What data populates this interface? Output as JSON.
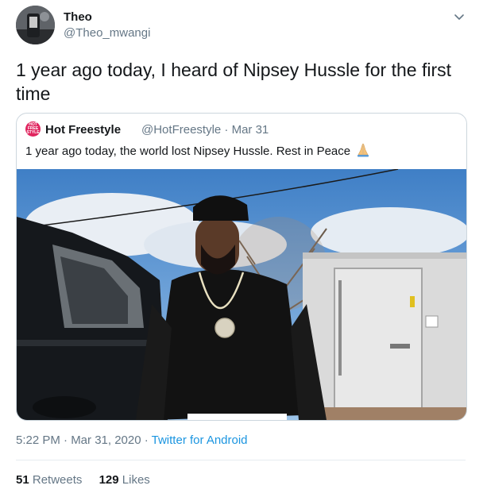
{
  "author": {
    "name": "Theo",
    "handle": "@Theo_mwangi",
    "avatar_icon": "profile-photo"
  },
  "menu_icon": "chevron-down-icon",
  "tweet_text": "1 year ago today, I heard of Nipsey Hussle for the first time",
  "quoted": {
    "avatar_text": "HOT FREE STYLE",
    "name": "Hot Freestyle",
    "handle_date": "@HotFreestyle · Mar 31",
    "text": "1 year ago today, the world lost Nipsey Hussle. Rest in Peace",
    "emoji": "folded-hands-icon",
    "photo_icon": "photo-man-by-car-and-door"
  },
  "meta": {
    "time_date": "5:22 PM · Mar 31, 2020 · ",
    "source": "Twitter for Android"
  },
  "stats": {
    "retweets_count": "51",
    "retweets_label": "Retweets",
    "likes_count": "129",
    "likes_label": "Likes"
  },
  "colors": {
    "link": "#1b95e0",
    "secondary_text": "#657786",
    "primary_text": "#14171a",
    "border": "#ccd6dd"
  }
}
